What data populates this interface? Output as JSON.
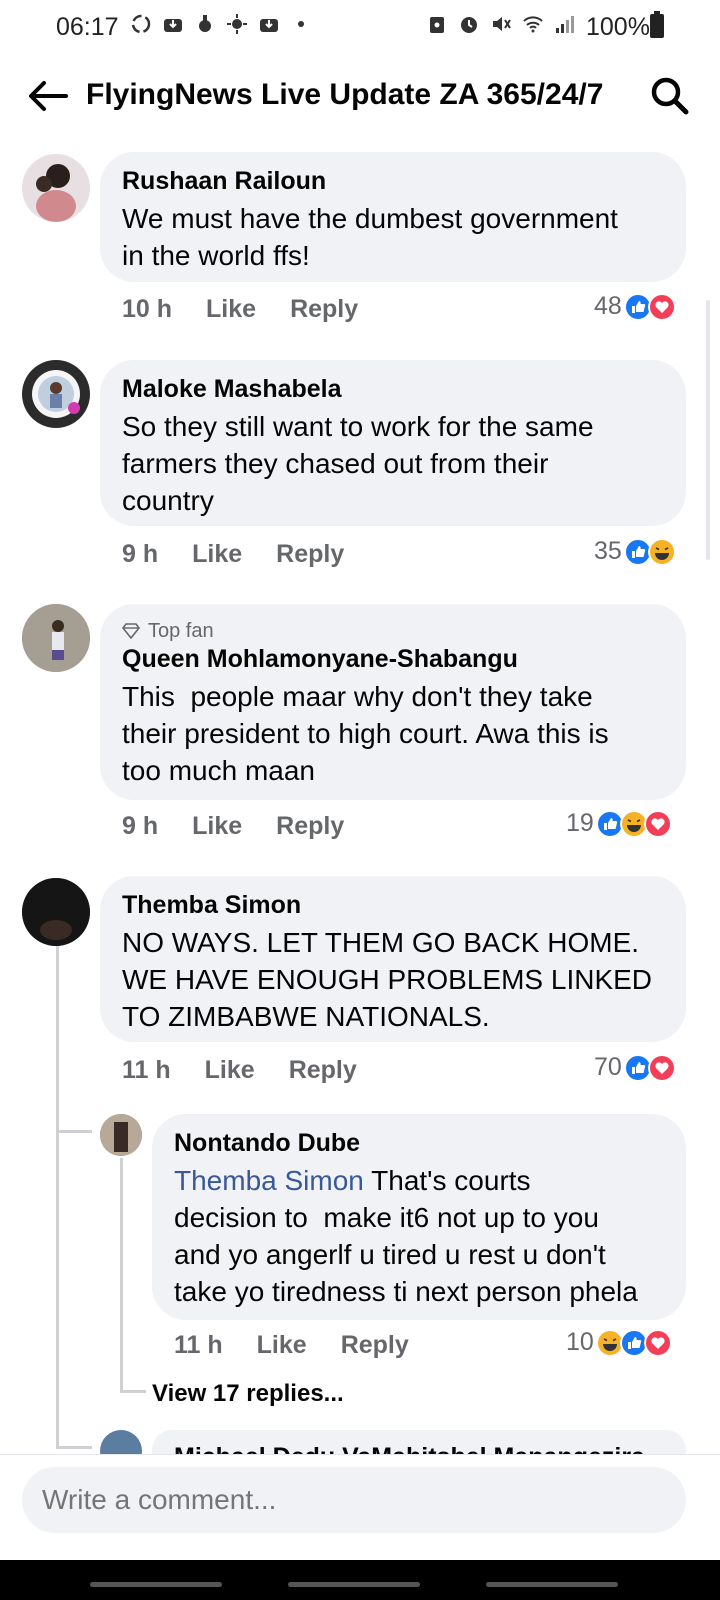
{
  "status_bar": {
    "time": "06:17",
    "battery": "100%",
    "left_icons": [
      "sync-icon",
      "download-icon",
      "sync-icon",
      "weather-icon",
      "download-icon",
      "dot-icon"
    ],
    "right_icons": [
      "lock-icon",
      "alarm-icon",
      "mute-icon",
      "wifi-icon",
      "signal-icon"
    ]
  },
  "header": {
    "title": "FlyingNews Live Update ZA 365/24/7"
  },
  "comments": [
    {
      "name": "Rushaan Railoun",
      "lines": [
        "We must have the dumbest government",
        "in the world ffs!"
      ],
      "time": "10 h",
      "like_label": "Like",
      "reply_label": "Reply",
      "reaction_count": "48",
      "reactions": [
        "like",
        "love"
      ]
    },
    {
      "name": "Maloke Mashabela",
      "lines": [
        "So they still want to work for the same",
        "farmers they chased out from their",
        "country"
      ],
      "time": "9 h",
      "like_label": "Like",
      "reply_label": "Reply",
      "reaction_count": "35",
      "reactions": [
        "like",
        "haha"
      ]
    },
    {
      "badge": "Top fan",
      "name": "Queen Mohlamonyane-Shabangu",
      "lines": [
        "This  people maar why don't they take",
        "their president to high court. Awa this is",
        "too much maan"
      ],
      "time": "9 h",
      "like_label": "Like",
      "reply_label": "Reply",
      "reaction_count": "19",
      "reactions": [
        "like",
        "haha",
        "love"
      ]
    },
    {
      "name": "Themba Simon",
      "lines": [
        "NO WAYS. LET THEM GO BACK HOME.",
        "WE HAVE ENOUGH PROBLEMS LINKED",
        "TO ZIMBABWE NATIONALS."
      ],
      "time": "11 h",
      "like_label": "Like",
      "reply_label": "Reply",
      "reaction_count": "70",
      "reactions": [
        "like",
        "love"
      ]
    }
  ],
  "reply": {
    "name": "Nontando Dube",
    "mention": "Themba Simon",
    "first_line_rest": " That's courts",
    "lines": [
      "decision to  make it6 not up to you",
      "and yo angerlf u tired u rest u don't",
      "take yo tiredness ti next person phela"
    ],
    "time": "11 h",
    "like_label": "Like",
    "reply_label": "Reply",
    "reaction_count": "10",
    "reactions": [
      "haha",
      "like",
      "love"
    ]
  },
  "view_replies": "View 17 replies...",
  "partial_next_name": "Michael Dedu VaMahitsbel Manangezira",
  "composer": {
    "placeholder": "Write a comment..."
  },
  "colors": {
    "bubble": "#f0f2f5",
    "like": "#1877f2",
    "love": "#f33e58",
    "haha": "#f7b125",
    "mention": "#385898",
    "secondary_text": "#65676b"
  }
}
